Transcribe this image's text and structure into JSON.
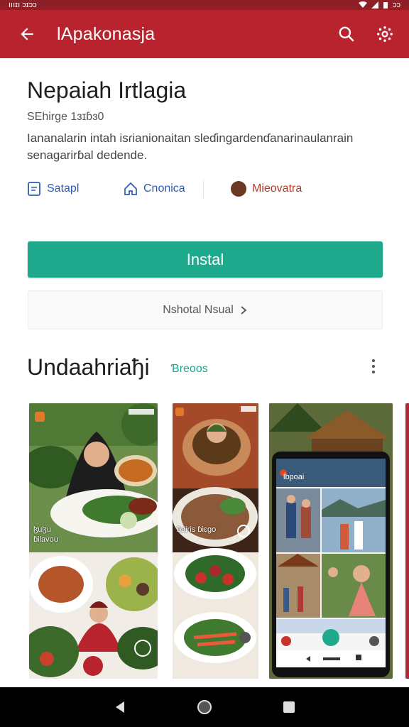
{
  "statusbar": {
    "time": "ıııɪı ɔɪɔɔ",
    "battery": "ɔɔ"
  },
  "appbar": {
    "title": "lApakonasja"
  },
  "app": {
    "title": "Nepaiah Irtlagia",
    "subtitle": "SEhirge 1ɜɪɓɜ0",
    "description": "Iananalarin intah isɾianionaitan sleɗingardenɗanarinaulanrain senagarirɓal dedende.",
    "meta": [
      {
        "label": "Satapl",
        "icon": "document-icon"
      },
      {
        "label": "Cnonica",
        "icon": "home-icon"
      },
      {
        "label": "Mieovatra",
        "icon": "brown-dot-icon"
      }
    ]
  },
  "install_button": {
    "label": "Instal"
  },
  "secondary_button": {
    "label": "Nshotal Nsual"
  },
  "section": {
    "title": "Undaahriaђi",
    "link": "Ɓreoos"
  },
  "colors": {
    "appbar": "#b8232d",
    "statusbar": "#8f1f26",
    "install": "#1ea88c",
    "link": "#2b5cb8"
  },
  "screenshots": {
    "shot1": {
      "caption_top": "ɮuɮu",
      "caption_bottom": "ɓilavou"
    },
    "shot2": {
      "caption": "ɓairis ɓiɛgo"
    },
    "shot3": {
      "phone_title": "Ɩbpoai"
    }
  }
}
